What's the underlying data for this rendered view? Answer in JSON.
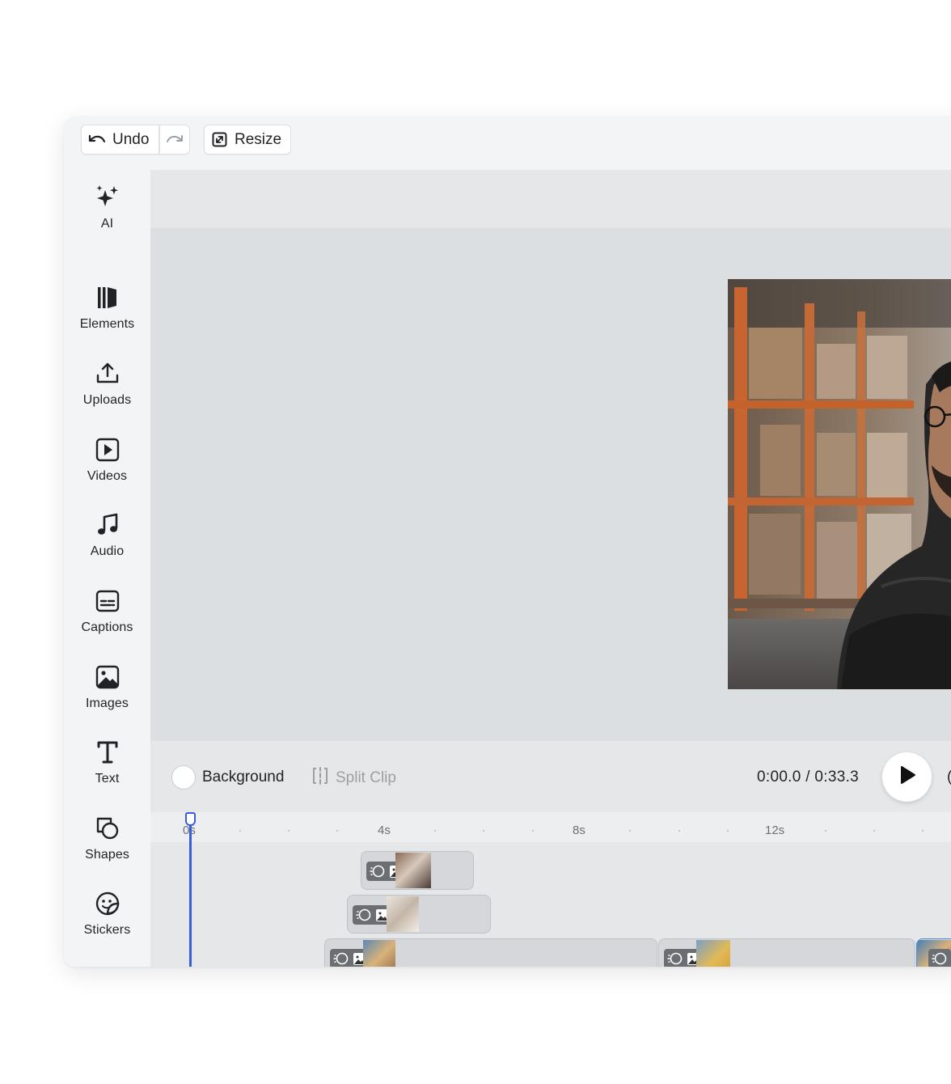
{
  "toolbar": {
    "undo_label": "Undo",
    "resize_label": "Resize"
  },
  "sidebar": {
    "items": [
      {
        "label": "AI",
        "icon": "sparkles-icon"
      },
      {
        "label": "Elements",
        "icon": "elements-icon"
      },
      {
        "label": "Uploads",
        "icon": "upload-icon"
      },
      {
        "label": "Videos",
        "icon": "video-play-icon"
      },
      {
        "label": "Audio",
        "icon": "music-note-icon"
      },
      {
        "label": "Captions",
        "icon": "captions-icon"
      },
      {
        "label": "Images",
        "icon": "image-icon"
      },
      {
        "label": "Text",
        "icon": "text-icon"
      },
      {
        "label": "Shapes",
        "icon": "shapes-icon"
      },
      {
        "label": "Stickers",
        "icon": "sticker-icon"
      }
    ]
  },
  "controls": {
    "background_label": "Background",
    "split_clip_label": "Split Clip",
    "current_time": "0:00.0",
    "separator": "/",
    "total_time": "0:33.3",
    "trailing_char": "("
  },
  "timeline": {
    "ticks": [
      "0s",
      "4s",
      "8s",
      "12s"
    ],
    "playhead_color": "#3b5bdb"
  }
}
